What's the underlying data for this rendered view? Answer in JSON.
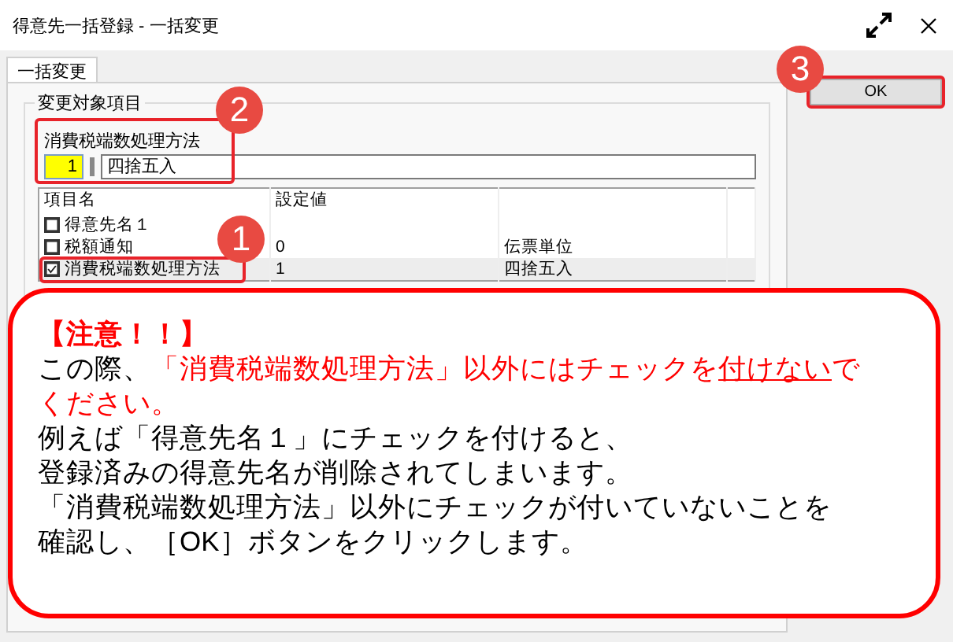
{
  "window": {
    "title": "得意先一括登録 - 一括変更"
  },
  "tabs": [
    {
      "label": "一括変更",
      "selected": true
    }
  ],
  "group": {
    "title": "変更対象項目",
    "field_label": "消費税端数処理方法",
    "code_value": "1",
    "value_text": "四捨五入"
  },
  "table": {
    "columns": [
      "項目名",
      "設定値"
    ],
    "rows": [
      {
        "name": "得意先名１",
        "checked": false,
        "selected": false,
        "value": "",
        "detail": ""
      },
      {
        "name": "税額通知",
        "checked": false,
        "selected": false,
        "value": "0",
        "detail": "伝票単位"
      },
      {
        "name": "消費税端数処理方法",
        "checked": true,
        "selected": true,
        "value": "1",
        "detail": "四捨五入"
      }
    ]
  },
  "buttons": [
    {
      "label": "OK"
    }
  ],
  "markers": [
    {
      "label": "1"
    },
    {
      "label": "2"
    },
    {
      "label": "3"
    }
  ],
  "notice": [
    {
      "kind": "heading",
      "parts": [
        {
          "text": "【注意！！】",
          "kind": "alert"
        }
      ]
    },
    {
      "kind": "body",
      "parts": [
        {
          "text": "この際、",
          "kind": "plain"
        },
        {
          "text": "「消費税端数処理方法」以外にはチェックを",
          "kind": "alert"
        },
        {
          "text": "付けない",
          "kind": "underlined"
        },
        {
          "text": "で",
          "kind": "alert"
        }
      ]
    },
    {
      "kind": "body",
      "parts": [
        {
          "text": "ください。",
          "kind": "alert"
        }
      ]
    },
    {
      "kind": "body",
      "parts": [
        {
          "text": "例えば「得意先名１」にチェックを付けると、",
          "kind": "plain"
        }
      ]
    },
    {
      "kind": "body",
      "parts": [
        {
          "text": "登録済みの得意先名が削除されてしまいます。",
          "kind": "plain"
        }
      ]
    },
    {
      "kind": "body",
      "parts": [
        {
          "text": "「消費税端数処理方法」以外にチェックが付いていないことを",
          "kind": "plain"
        }
      ]
    },
    {
      "kind": "body",
      "parts": [
        {
          "text": "確認し、［OK］ボタンをクリックします。",
          "kind": "plain"
        }
      ]
    }
  ]
}
